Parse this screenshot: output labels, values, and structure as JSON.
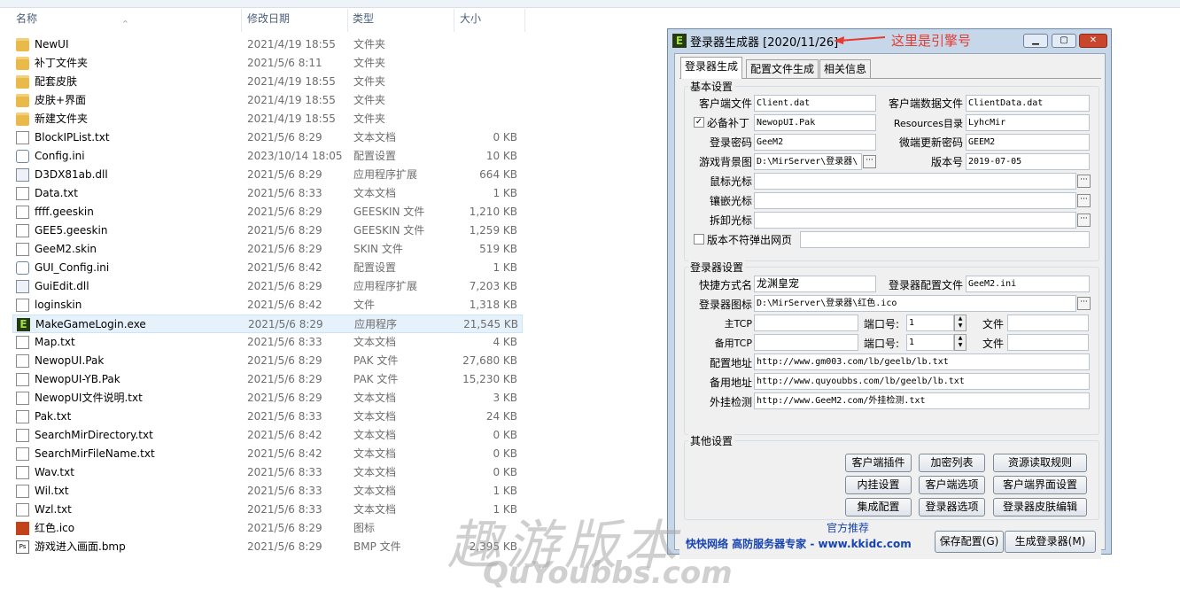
{
  "columns": {
    "name": "名称",
    "date": "修改日期",
    "type": "类型",
    "size": "大小"
  },
  "files": [
    {
      "name": "NewUI",
      "date": "2021/4/19 18:55",
      "type": "文件夹",
      "size": "",
      "icon": "folder-icon"
    },
    {
      "name": "补丁文件夹",
      "date": "2021/5/6 8:11",
      "type": "文件夹",
      "size": "",
      "icon": "folder-icon"
    },
    {
      "name": "配套皮肤",
      "date": "2021/4/19 18:55",
      "type": "文件夹",
      "size": "",
      "icon": "folder-icon"
    },
    {
      "name": "皮肤+界面",
      "date": "2021/4/19 18:55",
      "type": "文件夹",
      "size": "",
      "icon": "folder-icon"
    },
    {
      "name": "新建文件夹",
      "date": "2021/4/19 18:55",
      "type": "文件夹",
      "size": "",
      "icon": "folder-icon"
    },
    {
      "name": "BlockIPList.txt",
      "date": "2021/5/6 8:29",
      "type": "文本文档",
      "size": "0 KB",
      "icon": "text-file-icon"
    },
    {
      "name": "Config.ini",
      "date": "2023/10/14 18:05",
      "type": "配置设置",
      "size": "10 KB",
      "icon": "config-file-icon"
    },
    {
      "name": "D3DX81ab.dll",
      "date": "2021/5/6 8:29",
      "type": "应用程序扩展",
      "size": "664 KB",
      "icon": "dll-file-icon"
    },
    {
      "name": "Data.txt",
      "date": "2021/5/6 8:33",
      "type": "文本文档",
      "size": "1 KB",
      "icon": "text-file-icon"
    },
    {
      "name": "ffff.geeskin",
      "date": "2021/5/6 8:29",
      "type": "GEESKIN 文件",
      "size": "1,210 KB",
      "icon": "file-icon"
    },
    {
      "name": "GEE5.geeskin",
      "date": "2021/5/6 8:29",
      "type": "GEESKIN 文件",
      "size": "1,259 KB",
      "icon": "file-icon"
    },
    {
      "name": "GeeM2.skin",
      "date": "2021/5/6 8:29",
      "type": "SKIN 文件",
      "size": "519 KB",
      "icon": "file-icon"
    },
    {
      "name": "GUI_Config.ini",
      "date": "2021/5/6 8:42",
      "type": "配置设置",
      "size": "1 KB",
      "icon": "config-file-icon"
    },
    {
      "name": "GuiEdit.dll",
      "date": "2021/5/6 8:29",
      "type": "应用程序扩展",
      "size": "7,203 KB",
      "icon": "dll-file-icon"
    },
    {
      "name": "loginskin",
      "date": "2021/5/6 8:42",
      "type": "文件",
      "size": "1,318 KB",
      "icon": "file-icon"
    },
    {
      "name": "MakeGameLogin.exe",
      "date": "2021/5/6 8:29",
      "type": "应用程序",
      "size": "21,545 KB",
      "icon": "exe-icon",
      "selected": true
    },
    {
      "name": "Map.txt",
      "date": "2021/5/6 8:33",
      "type": "文本文档",
      "size": "4 KB",
      "icon": "text-file-icon"
    },
    {
      "name": "NewopUI.Pak",
      "date": "2021/5/6 8:29",
      "type": "PAK 文件",
      "size": "27,680 KB",
      "icon": "file-icon"
    },
    {
      "name": "NewopUI-YB.Pak",
      "date": "2021/5/6 8:29",
      "type": "PAK 文件",
      "size": "15,230 KB",
      "icon": "file-icon"
    },
    {
      "name": "NewopUI文件说明.txt",
      "date": "2021/5/6 8:29",
      "type": "文本文档",
      "size": "3 KB",
      "icon": "text-file-icon"
    },
    {
      "name": "Pak.txt",
      "date": "2021/5/6 8:33",
      "type": "文本文档",
      "size": "24 KB",
      "icon": "text-file-icon"
    },
    {
      "name": "SearchMirDirectory.txt",
      "date": "2021/5/6 8:42",
      "type": "文本文档",
      "size": "0 KB",
      "icon": "text-file-icon"
    },
    {
      "name": "SearchMirFileName.txt",
      "date": "2021/5/6 8:42",
      "type": "文本文档",
      "size": "0 KB",
      "icon": "text-file-icon"
    },
    {
      "name": "Wav.txt",
      "date": "2021/5/6 8:33",
      "type": "文本文档",
      "size": "0 KB",
      "icon": "text-file-icon"
    },
    {
      "name": "Wil.txt",
      "date": "2021/5/6 8:33",
      "type": "文本文档",
      "size": "1 KB",
      "icon": "text-file-icon"
    },
    {
      "name": "Wzl.txt",
      "date": "2021/5/6 8:33",
      "type": "文本文档",
      "size": "1 KB",
      "icon": "text-file-icon"
    },
    {
      "name": "红色.ico",
      "date": "2021/5/6 8:29",
      "type": "图标",
      "size": "",
      "icon": "ico-file-icon"
    },
    {
      "name": "游戏进入画面.bmp",
      "date": "2021/5/6 8:29",
      "type": "BMP 文件",
      "size": "2,395 KB",
      "icon": "bmp-file-icon"
    }
  ],
  "dialog": {
    "title": "登录器生成器 [2020/11/26]",
    "annotation": "这里是引擎号",
    "tabs": [
      "登录器生成",
      "配置文件生成",
      "相关信息"
    ],
    "basic": {
      "group_label": "基本设置",
      "client_file_label": "客户端文件",
      "client_file": "Client.dat",
      "client_data_label": "客户端数据文件",
      "client_data": "ClientData.dat",
      "patch_label": "必备补丁",
      "patch": "NewopUI.Pak",
      "resources_label": "Resources目录",
      "resources": "LyhcMir",
      "password_label": "登录密码",
      "password": "GeeM2",
      "update_password_label": "微端更新密码",
      "update_password": "GEEM2",
      "background_label": "游戏背景图",
      "background": "D:\\MirServer\\登录器\\",
      "version_label": "版本号",
      "version": "2019-07-05",
      "mouse_cursor_label": "鼠标光标",
      "inlay_cursor_label": "镶嵌光标",
      "remove_cursor_label": "拆卸光标",
      "version_popup_label": "版本不符弹出网页"
    },
    "launcher": {
      "group_label": "登录器设置",
      "shortcut_label": "快捷方式名",
      "shortcut": "龙渊皇宠",
      "config_file_label": "登录器配置文件",
      "config_file": "GeeM2.ini",
      "icon_label": "登录器图标",
      "icon_path": "D:\\MirServer\\登录器\\红色.ico",
      "main_tcp_label": "主TCP",
      "backup_tcp_label": "备用TCP",
      "port_label": "端口号:",
      "port1": "1",
      "port2": "1",
      "file_label": "文件",
      "config_url_label": "配置地址",
      "config_url": "http://www.gm003.com/lb/geelb/lb.txt",
      "backup_url_label": "备用地址",
      "backup_url": "http://www.quyoubbs.com/lb/geelb/lb.txt",
      "cheat_check_label": "外挂检测",
      "cheat_check": "http://www.GeeM2.com/外挂检测.txt"
    },
    "other": {
      "group_label": "其他设置",
      "buttons": [
        "客户端插件",
        "加密列表",
        "资源读取规则",
        "内挂设置",
        "客户端选项",
        "客户端界面设置",
        "集成配置",
        "登录器选项",
        "登录器皮肤编辑"
      ]
    },
    "footer": {
      "official": "官方推荐",
      "ad": "快快网络 高防服务器专家 - www.kkidc.com",
      "save_button": "保存配置(G)",
      "generate_button": "生成登录器(M)"
    }
  },
  "watermark": {
    "line1": "趣游版本",
    "line2": "QuYoubbs.com"
  }
}
